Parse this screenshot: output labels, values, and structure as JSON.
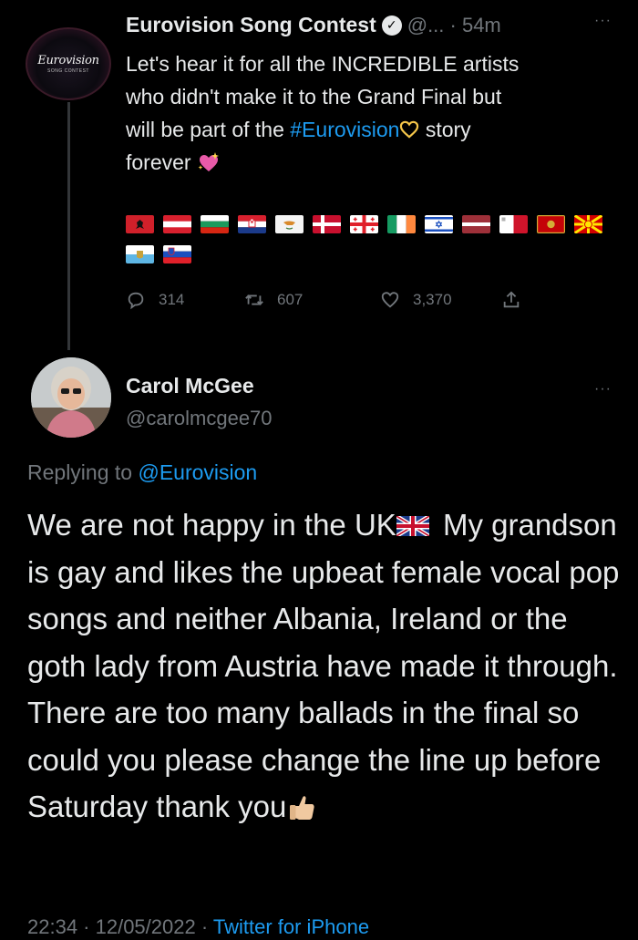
{
  "parent_tweet": {
    "author_name": "Eurovision Song Contest",
    "verified_glyph": "✓",
    "handle_time": "@... · 54m",
    "avatar_logo_text": "Eurovision",
    "avatar_logo_sub": "SONG CONTEST",
    "more_glyph": "···",
    "text_line1": "Let's hear it for all the INCREDIBLE artists",
    "text_line2": "who didn't make it to the Grand Final but",
    "text_line3_pre": "will be part of the ",
    "hashtag": "#Eurovision",
    "text_line3_post": " story",
    "text_line4": "forever",
    "flags_row1": [
      "albania-flag",
      "austria-flag",
      "bulgaria-flag",
      "croatia-flag",
      "cyprus-flag",
      "denmark-flag",
      "georgia-flag",
      "ireland-flag",
      "israel-flag",
      "latvia-flag",
      "malta-flag",
      "montenegro-flag",
      "north-macedonia-flag"
    ],
    "flags_row2": [
      "san-marino-flag",
      "slovenia-flag"
    ],
    "stats": {
      "replies": "314",
      "retweets": "607",
      "likes": "3,370"
    }
  },
  "reply_tweet": {
    "author_name": "Carol McGee",
    "handle": "@carolmcgee70",
    "more_glyph": "···",
    "replying_prefix": "Replying to ",
    "replying_mention": "@Eurovision",
    "body_part1": "We are not happy in the UK",
    "body_part2": " My grandson is gay and likes the upbeat female vocal pop songs and neither Albania, Ireland or the goth lady from Austria have made it through. There are too many ballads in the final so could you please change the line up before Saturday thank you",
    "timestamp": "22:34 · 12/05/2022 · ",
    "source": "Twitter for iPhone"
  },
  "colors": {
    "background": "#000000",
    "primary_text": "#e7e9ea",
    "secondary_text": "#71767b",
    "link": "#1d9bf0"
  }
}
